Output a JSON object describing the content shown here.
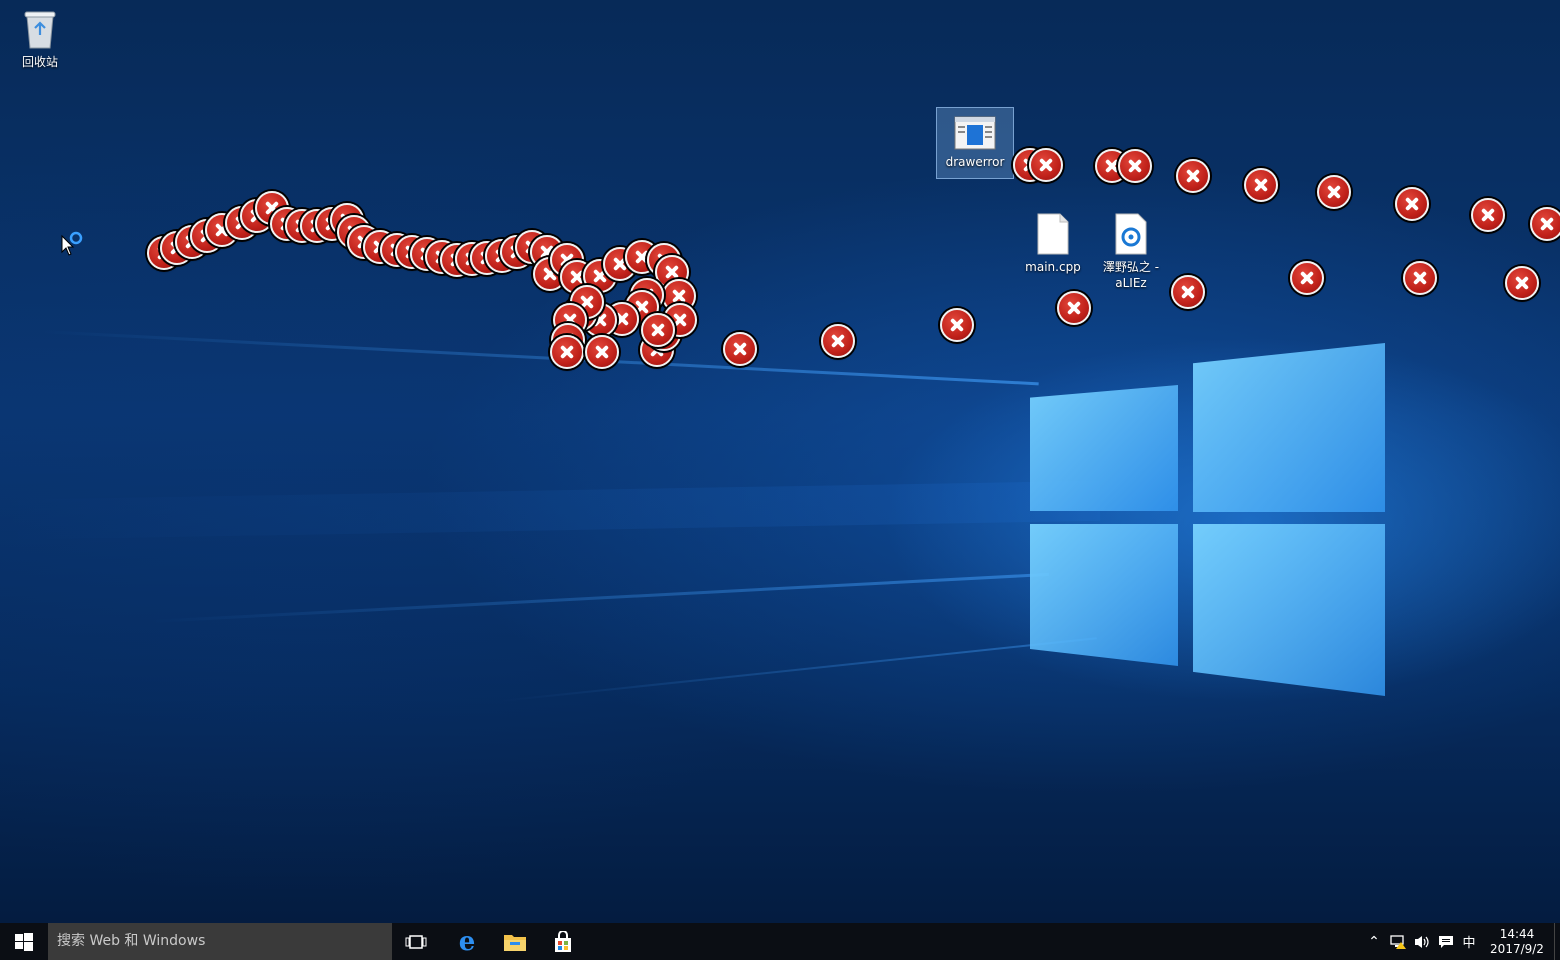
{
  "desktop": {
    "icons": {
      "recycle_bin": "回收站",
      "drawerror": "drawerror",
      "main_cpp": "main.cpp",
      "music_file_line1": "澤野弘之 -",
      "music_file_line2": "aLIEz"
    },
    "cursor": "mouse-pointer-busy-icon",
    "error_icons": "error-x-icon"
  },
  "taskbar": {
    "start": "windows-start-icon",
    "search_placeholder": "搜索 Web 和 Windows",
    "pinned": [
      "task-view-icon",
      "edge-icon",
      "file-explorer-icon",
      "store-icon"
    ],
    "tray": {
      "ime": "中",
      "time": "14:44",
      "date": "2017/9/2"
    }
  },
  "colors": {
    "wallpaper_dark": "#062a5c",
    "wallpaper_glow": "#4db8ff",
    "error_red": "#c0211a",
    "taskbar": "#0b0e14"
  }
}
